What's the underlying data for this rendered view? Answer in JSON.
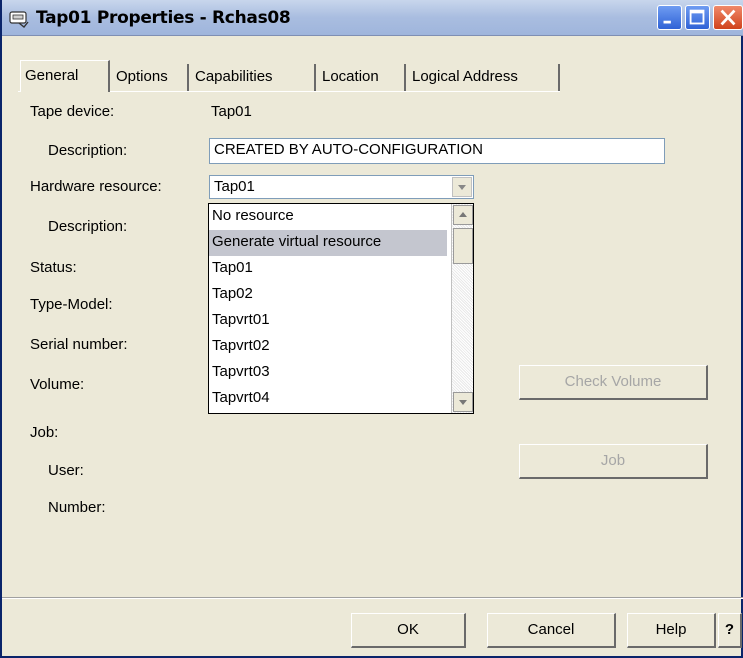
{
  "window": {
    "title": "Tap01 Properties - Rchas08"
  },
  "tabs": [
    {
      "label": "General",
      "active": true
    },
    {
      "label": "Options",
      "active": false
    },
    {
      "label": "Capabilities",
      "active": false
    },
    {
      "label": "Location",
      "active": false
    },
    {
      "label": "Logical Address",
      "active": false
    }
  ],
  "form": {
    "tape_device_label": "Tape device:",
    "tape_device_value": "Tap01",
    "description_label": "Description:",
    "description_value": "CREATED BY AUTO-CONFIGURATION",
    "hardware_resource_label": "Hardware resource:",
    "hardware_resource_value": "Tap01",
    "hw_description_label": "Description:",
    "status_label": "Status:",
    "type_model_label": "Type-Model:",
    "serial_number_label": "Serial number:",
    "volume_label": "Volume:",
    "job_label": "Job:",
    "user_label": "User:",
    "number_label": "Number:"
  },
  "dropdown": {
    "options": [
      "No resource",
      "Generate virtual resource",
      "Tap01",
      "Tap02",
      "Tapvrt01",
      "Tapvrt02",
      "Tapvrt03",
      "Tapvrt04"
    ],
    "highlighted": "Generate virtual resource"
  },
  "buttons": {
    "check_volume": "Check Volume",
    "job": "Job",
    "ok": "OK",
    "cancel": "Cancel",
    "help": "Help",
    "whats_this": "?"
  },
  "icons": {
    "title": "device-properties-icon",
    "minimize": "minimize-icon",
    "maximize": "maximize-icon",
    "close": "close-icon"
  }
}
